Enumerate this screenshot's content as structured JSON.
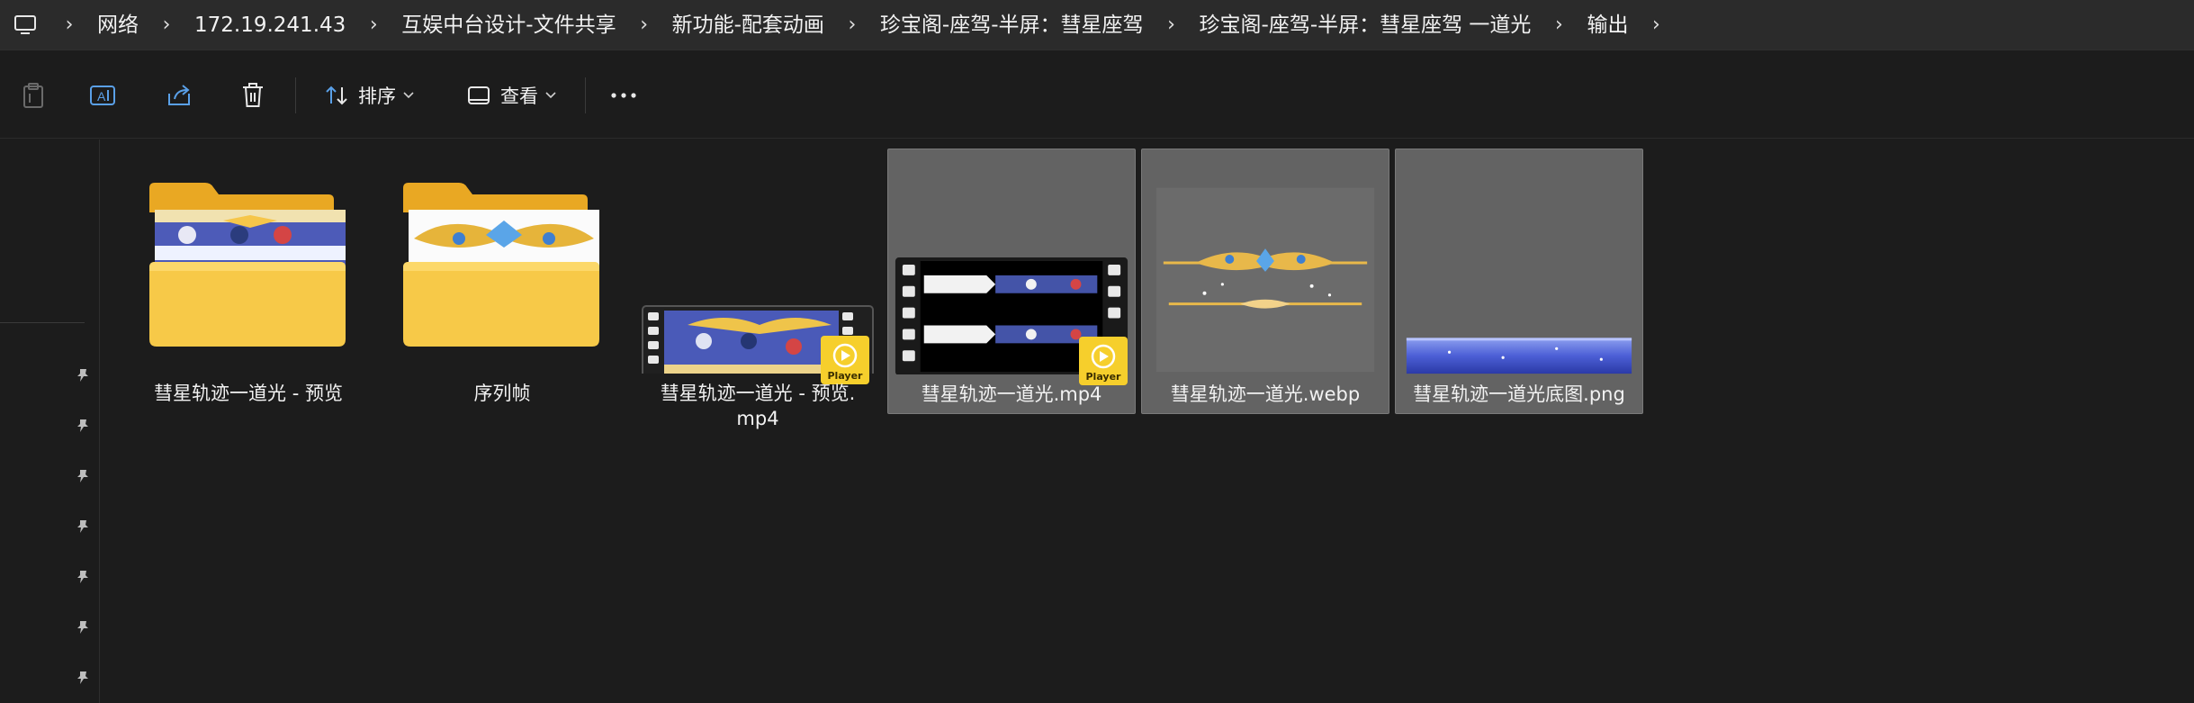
{
  "breadcrumb": {
    "items": [
      "网络",
      "172.19.241.43",
      "互娱中台设计-文件共享",
      "新功能-配套动画",
      "珍宝阁-座驾-半屏：彗星座驾",
      "珍宝阁-座驾-半屏：彗星座驾 一道光",
      "输出"
    ]
  },
  "toolbar": {
    "sort_label": "排序",
    "view_label": "查看"
  },
  "files": [
    {
      "name": "彗星轨迹一道光 - 预览",
      "kind": "folder-preview"
    },
    {
      "name": "序列帧",
      "kind": "folder"
    },
    {
      "name_line1": "彗星轨迹一道光 - 预览.",
      "name_line2": "mp4",
      "kind": "video",
      "badge": "Player"
    },
    {
      "name": "彗星轨迹一道光.mp4",
      "kind": "video-selected",
      "badge": "Player"
    },
    {
      "name": "彗星轨迹一道光.webp",
      "kind": "image-selected"
    },
    {
      "name": "彗星轨迹一道光底图.png",
      "kind": "image-selected"
    }
  ],
  "colors": {
    "background": "#1c1c1c",
    "address_bar": "#2b2b2b",
    "selected_tile": "#636363",
    "folder_yellow": "#f7c948",
    "player_badge": "#f6cf2c"
  }
}
